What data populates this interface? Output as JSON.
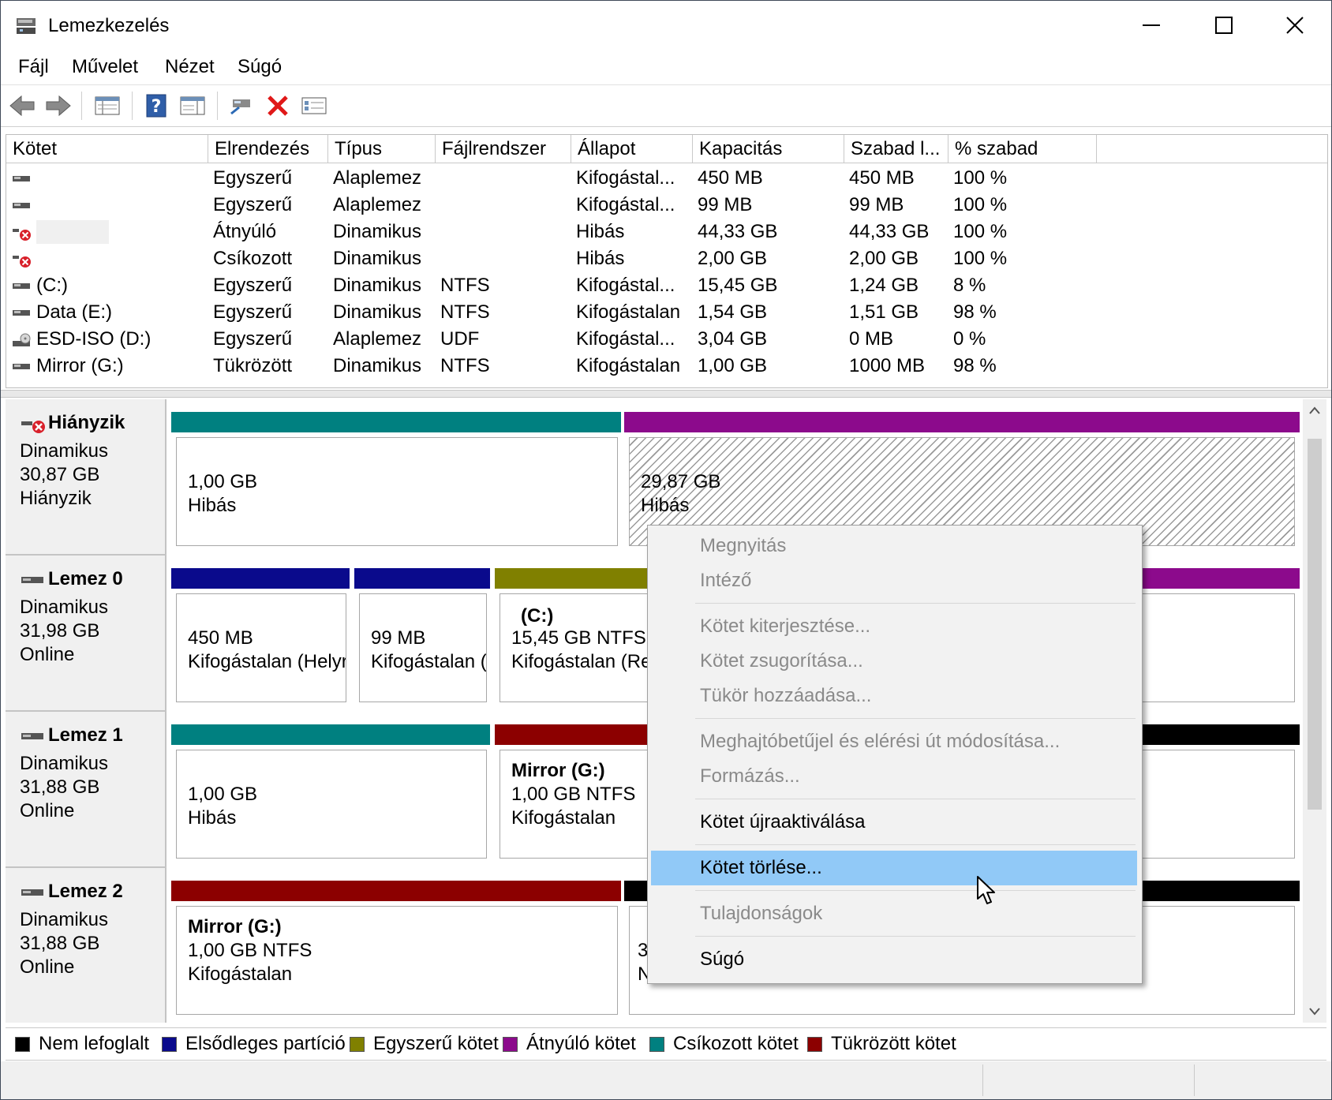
{
  "window": {
    "title": "Lemezkezelés"
  },
  "menu": [
    "Fájl",
    "Művelet",
    "Nézet",
    "Súgó"
  ],
  "toolbar": {
    "buttons": [
      "back-arrow-icon",
      "forward-arrow-icon",
      "disk-list-icon",
      "help-icon",
      "properties-icon",
      "connect-icon",
      "delete-x-icon",
      "checklist-icon"
    ]
  },
  "volume_table": {
    "columns": [
      "Kötet",
      "Elrendezés",
      "Típus",
      "Fájlrendszer",
      "Állapot",
      "Kapacitás",
      "Szabad l...",
      "% szabad"
    ],
    "rows": [
      {
        "icon": "drive-icon",
        "name": "",
        "layout": "Egyszerű",
        "type": "Alaplemez",
        "fs": "",
        "status": "Kifogástal...",
        "cap": "450 MB",
        "free": "450 MB",
        "pct": "100 %"
      },
      {
        "icon": "drive-icon",
        "name": "",
        "layout": "Egyszerű",
        "type": "Alaplemez",
        "fs": "",
        "status": "Kifogástal...",
        "cap": "99 MB",
        "free": "99 MB",
        "pct": "100 %"
      },
      {
        "icon": "drive-error-icon",
        "name": "",
        "layout": "Átnyúló",
        "type": "Dinamikus",
        "fs": "",
        "status": "Hibás",
        "cap": "44,33 GB",
        "free": "44,33 GB",
        "pct": "100 %"
      },
      {
        "icon": "drive-error-icon",
        "name": "",
        "layout": "Csíkozott",
        "type": "Dinamikus",
        "fs": "",
        "status": "Hibás",
        "cap": "2,00 GB",
        "free": "2,00 GB",
        "pct": "100 %"
      },
      {
        "icon": "drive-icon",
        "name": "(C:)",
        "layout": "Egyszerű",
        "type": "Dinamikus",
        "fs": "NTFS",
        "status": "Kifogástal...",
        "cap": "15,45 GB",
        "free": "1,24 GB",
        "pct": "8 %"
      },
      {
        "icon": "drive-icon",
        "name": "Data (E:)",
        "layout": "Egyszerű",
        "type": "Dinamikus",
        "fs": "NTFS",
        "status": "Kifogástalan",
        "cap": "1,54 GB",
        "free": "1,51 GB",
        "pct": "98 %"
      },
      {
        "icon": "cd-drive-icon",
        "name": "ESD-ISO (D:)",
        "layout": "Egyszerű",
        "type": "Alaplemez",
        "fs": "UDF",
        "status": "Kifogástal...",
        "cap": "3,04 GB",
        "free": "0 MB",
        "pct": "0 %"
      },
      {
        "icon": "drive-icon",
        "name": "Mirror (G:)",
        "layout": "Tükrözött",
        "type": "Dinamikus",
        "fs": "NTFS",
        "status": "Kifogástalan",
        "cap": "1,00 GB",
        "free": "1000 MB",
        "pct": "98 %"
      }
    ]
  },
  "disks": [
    {
      "name": "Hiányzik",
      "type": "Dinamikus",
      "size": "30,87 GB",
      "state": "Hiányzik",
      "partitions": [
        {
          "lines": [
            "1,00 GB",
            "Hibás"
          ]
        },
        {
          "lines": [
            "29,87 GB",
            "Hibás"
          ]
        }
      ]
    },
    {
      "name": "Lemez 0",
      "type": "Dinamikus",
      "size": "31,98 GB",
      "state": "Online",
      "partitions": [
        {
          "lines": [
            "450 MB",
            "Kifogástalan (Helyr"
          ]
        },
        {
          "lines": [
            "99 MB",
            "Kifogástalan ("
          ]
        },
        {
          "title": "(C:)",
          "lines": [
            "15,45 GB NTFS",
            "Kifogástalan (Rer"
          ]
        },
        {
          "lines": []
        }
      ]
    },
    {
      "name": "Lemez 1",
      "type": "Dinamikus",
      "size": "31,88 GB",
      "state": "Online",
      "partitions": [
        {
          "lines": [
            "1,00 GB",
            "Hibás"
          ]
        },
        {
          "title": "Mirror  (G:)",
          "lines": [
            "1,00 GB NTFS",
            "Kifogástalan"
          ]
        },
        {
          "lines": []
        }
      ]
    },
    {
      "name": "Lemez 2",
      "type": "Dinamikus",
      "size": "31,88 GB",
      "state": "Online",
      "partitions": [
        {
          "title": "Mirror  (G:)",
          "lines": [
            "1,00 GB NTFS",
            "Kifogástalan"
          ]
        },
        {
          "lines": [
            "3(",
            "N"
          ]
        }
      ]
    }
  ],
  "legend": [
    {
      "label": "Nem lefoglalt",
      "color": "#000000"
    },
    {
      "label": "Elsődleges partíció",
      "color": "#0a0a8c"
    },
    {
      "label": "Egyszerű kötet",
      "color": "#808000"
    },
    {
      "label": "Átnyúló kötet",
      "color": "#8c0a8c"
    },
    {
      "label": "Csíkozott kötet",
      "color": "#008080"
    },
    {
      "label": "Tükrözött kötet",
      "color": "#8c0000"
    }
  ],
  "colors": {
    "primary": "#0a0a8c",
    "simple": "#808000",
    "spanned": "#8c0a8c",
    "striped": "#008080",
    "mirrored": "#8c0000",
    "unallocated": "#000000",
    "menu_highlight": "#91c9f7"
  },
  "context_menu": {
    "items": [
      {
        "label": "Megnyitás",
        "disabled": true
      },
      {
        "label": "Intéző",
        "disabled": true
      },
      {
        "label": "Kötet kiterjesztése...",
        "disabled": true
      },
      {
        "label": "Kötet zsugorítása...",
        "disabled": true
      },
      {
        "label": "Tükör hozzáadása...",
        "disabled": true
      },
      {
        "label": "Meghajtóbetűjel és elérési út módosítása...",
        "disabled": true
      },
      {
        "label": "Formázás...",
        "disabled": true
      },
      {
        "label": "Kötet újraaktiválása",
        "disabled": false
      },
      {
        "label": "Kötet törlése...",
        "disabled": false,
        "highlighted": true
      },
      {
        "label": "Tulajdonságok",
        "disabled": true
      },
      {
        "label": "Súgó",
        "disabled": false
      }
    ]
  }
}
